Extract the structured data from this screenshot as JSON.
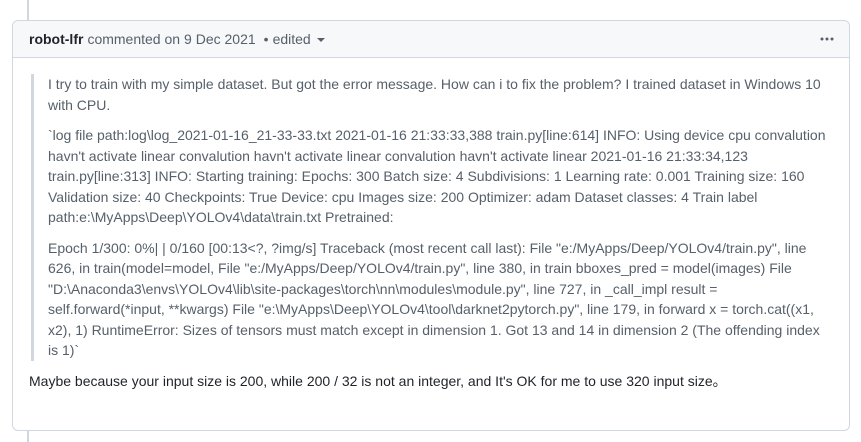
{
  "comment": {
    "author": "robot-lfr",
    "action": "commented on",
    "date": "9 Dec 2021",
    "separator": "•",
    "edited_label": "edited",
    "menu_glyph": "•••"
  },
  "quote": {
    "paragraphs": [
      "I try to train with my simple dataset. But got the error message. How can i to fix the problem? I trained dataset in Windows 10 with CPU.",
      "`log file path:log\\log_2021-01-16_21-33-33.txt 2021-01-16 21:33:33,388 train.py[line:614] INFO: Using device cpu convalution havn't activate linear convalution havn't activate linear convalution havn't activate linear 2021-01-16 21:33:34,123 train.py[line:313] INFO: Starting training: Epochs: 300 Batch size: 4 Subdivisions: 1 Learning rate: 0.001 Training size: 160 Validation size: 40 Checkpoints: True Device: cpu Images size: 200 Optimizer: adam Dataset classes: 4 Train label path:e:\\MyApps\\Deep\\YOLOv4\\data\\train.txt Pretrained:",
      "Epoch 1/300: 0%| | 0/160 [00:13<?, ?img/s] Traceback (most recent call last): File \"e:/MyApps/Deep/YOLOv4/train.py\", line 626, in train(model=model, File \"e:/MyApps/Deep/YOLOv4/train.py\", line 380, in train bboxes_pred = model(images) File \"D:\\Anaconda3\\envs\\YOLOv4\\lib\\site-packages\\torch\\nn\\modules\\module.py\", line 727, in _call_impl result = self.forward(*input, **kwargs) File \"e:\\MyApps\\Deep\\YOLOv4\\tool\\darknet2pytorch.py\", line 179, in forward x = torch.cat((x1, x2), 1) RuntimeError: Sizes of tensors must match except in dimension 1. Got 13 and 14 in dimension 2 (The offending index is 1)`"
    ]
  },
  "reply": "Maybe because your input size is 200, while 200 / 32 is not an integer, and It's OK for me to use 320 input size。",
  "icons": {
    "edited_dropdown": "chevron-down-icon",
    "menu": "kebab-horizontal-icon"
  }
}
